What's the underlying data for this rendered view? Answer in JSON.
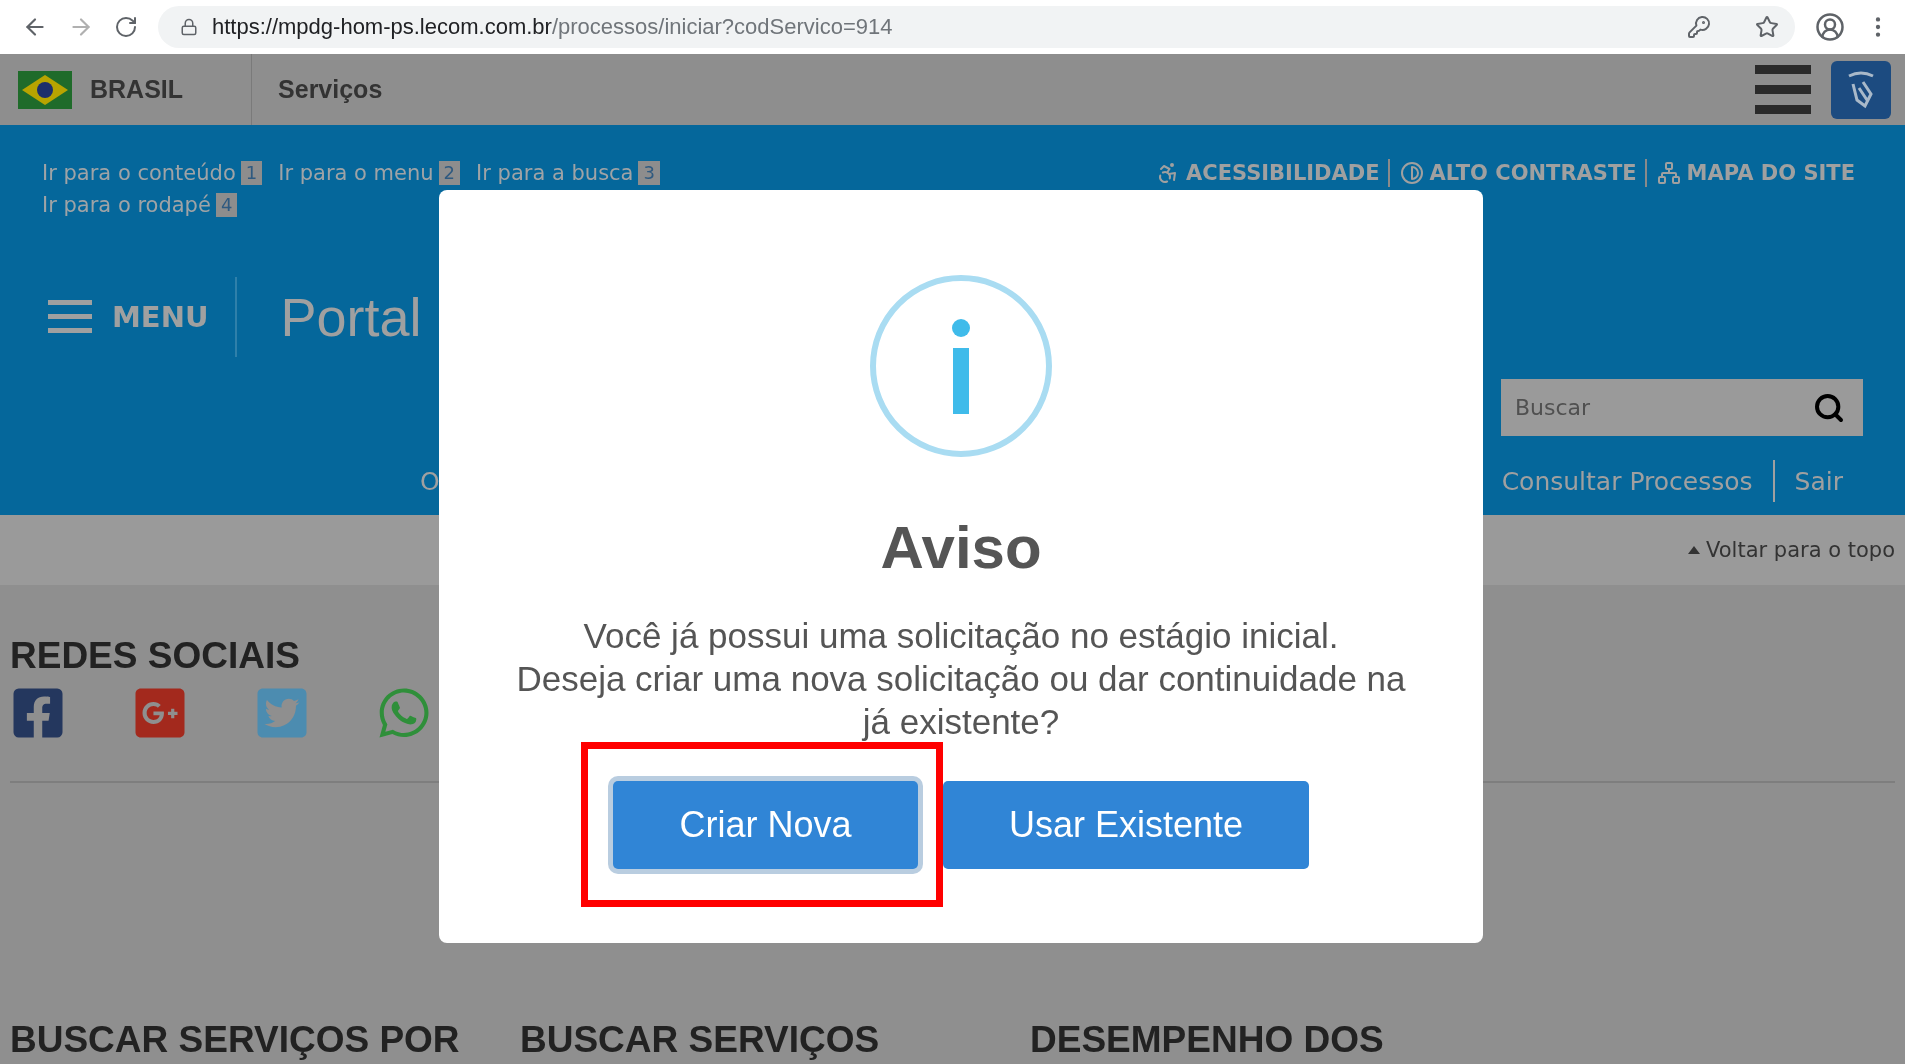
{
  "browser": {
    "url_host": "https://mpdg-hom-ps.lecom.com.br",
    "url_path": "/processos/iniciar?codServico=914"
  },
  "gov_bar": {
    "country": "BRASIL",
    "link": "Serviços"
  },
  "skip_links": [
    {
      "label": "Ir para o conteúdo",
      "key": "1"
    },
    {
      "label": "Ir para o menu",
      "key": "2"
    },
    {
      "label": "Ir para a busca",
      "key": "3"
    },
    {
      "label": "Ir para o rodapé",
      "key": "4"
    }
  ],
  "accessibility_links": [
    {
      "kind": "wheelchair",
      "label": "ACESSIBILIDADE"
    },
    {
      "kind": "contrast",
      "label": "ALTO CONTRASTE"
    },
    {
      "kind": "sitemap",
      "label": "MAPA DO SITE"
    }
  ],
  "menu_label": "MENU",
  "site_title": "Portal",
  "search": {
    "placeholder": "Buscar"
  },
  "nav": {
    "left": "O",
    "right": [
      "Consultar Processos",
      "Sair"
    ]
  },
  "back_to_top": "Voltar para o topo",
  "social": {
    "title": "REDES SOCIAIS",
    "networks": [
      {
        "kind": "facebook"
      },
      {
        "kind": "googleplus"
      },
      {
        "kind": "twitter"
      },
      {
        "kind": "whatsapp"
      }
    ]
  },
  "sections": [
    "BUSCAR SERVIÇOS POR",
    "BUSCAR SERVIÇOS",
    "DESEMPENHO DOS"
  ],
  "dialog": {
    "title": "Aviso",
    "message": [
      "Você já possui uma solicitação no estágio inicial.",
      "Deseja criar uma nova solicitação ou dar continuidade na já existente?"
    ],
    "buttons": [
      {
        "label": "Criar Nova",
        "focused": true,
        "highlighted": true
      },
      {
        "label": "Usar Existente",
        "focused": false,
        "highlighted": false
      }
    ]
  }
}
